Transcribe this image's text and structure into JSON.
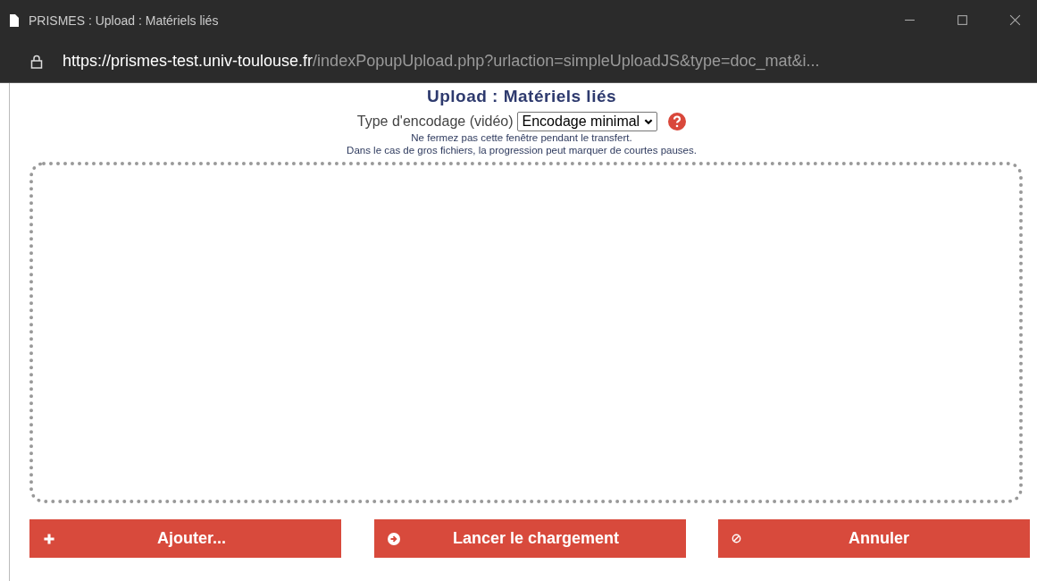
{
  "window": {
    "title": "PRISMES : Upload : Matériels liés"
  },
  "address_bar": {
    "host": "https://prismes-test.univ-toulouse.fr",
    "path": "/indexPopupUpload.php?urlaction=simpleUploadJS&type=doc_mat&i..."
  },
  "heading": "Upload : Matériels liés",
  "encoding": {
    "label": "Type d'encodage (vidéo)",
    "value": "Encodage minimal"
  },
  "notes": [
    "Ne fermez pas cette fenêtre pendant le transfert.",
    "Dans le cas de gros fichiers, la progression peut marquer de courtes pauses."
  ],
  "buttons": [
    {
      "label": "Ajouter...",
      "kind": "add"
    },
    {
      "label": "Lancer le chargement",
      "kind": "start"
    },
    {
      "label": "Annuler",
      "kind": "cancel"
    }
  ]
}
